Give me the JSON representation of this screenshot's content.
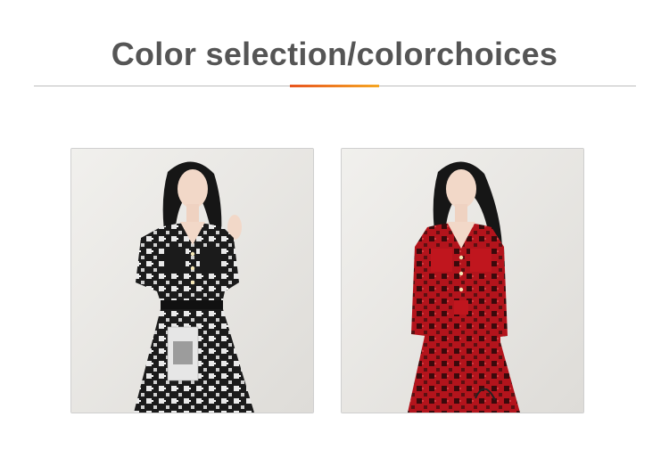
{
  "header": {
    "title": "Color selection/colorchoices"
  },
  "colors": {
    "title_text": "#555555",
    "accent_start": "#e8541e",
    "accent_end": "#f5a623",
    "rule": "#bdbdbd"
  },
  "products": [
    {
      "variant": "black-white-houndstooth",
      "main_color": "#1b1b1b"
    },
    {
      "variant": "red-houndstooth",
      "main_color": "#b3141c"
    }
  ]
}
